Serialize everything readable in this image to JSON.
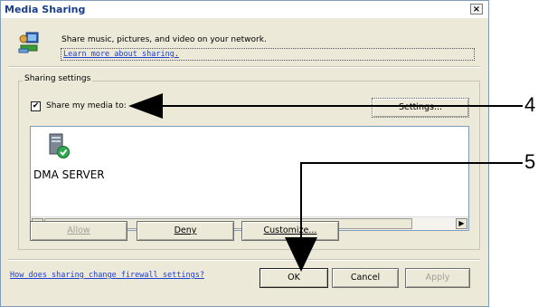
{
  "window": {
    "title": "Media Sharing",
    "close_glyph": "×"
  },
  "intro": {
    "text": "Share music, pictures, and video on your network.",
    "learn_link": "Learn more about sharing."
  },
  "sharing_settings": {
    "group_label": "Sharing settings",
    "share_checkbox_label": "Share my media to:",
    "share_checked": true,
    "settings_button": "Settings...",
    "devices": [
      {
        "name": "DMA SERVER",
        "icon": "media-server-icon"
      }
    ],
    "buttons": {
      "allow": "Allow",
      "deny": "Deny",
      "customize": "Customize..."
    }
  },
  "footer": {
    "firewall_link": "How does sharing change firewall settings?",
    "ok": "OK",
    "cancel": "Cancel",
    "apply": "Apply"
  },
  "callouts": {
    "settings": "4",
    "ok": "5"
  }
}
